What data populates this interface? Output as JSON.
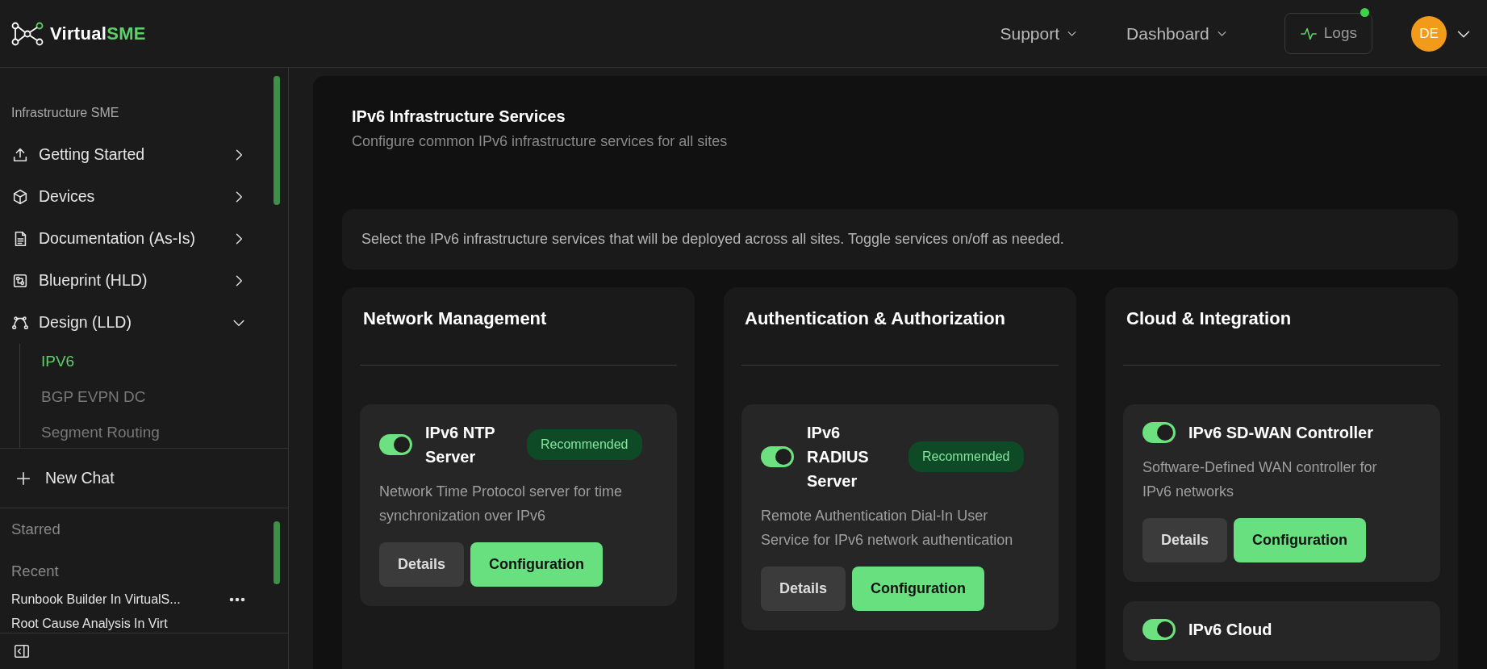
{
  "header": {
    "brand": {
      "text_main": "Virtual",
      "text_accent": "SME"
    },
    "menus": [
      {
        "label": "Support"
      },
      {
        "label": "Dashboard"
      }
    ],
    "logs_button": {
      "label": "Logs",
      "has_notification": true
    },
    "avatar": {
      "initials": "DE"
    }
  },
  "sidebar": {
    "section_label": "Infrastructure SME",
    "items": [
      {
        "label": "Getting Started",
        "expanded": false
      },
      {
        "label": "Devices",
        "expanded": false
      },
      {
        "label": "Documentation (As-Is)",
        "expanded": false
      },
      {
        "label": "Blueprint (HLD)",
        "expanded": false
      },
      {
        "label": "Design (LLD)",
        "expanded": true,
        "children": [
          {
            "label": "IPV6",
            "selected": true
          },
          {
            "label": "BGP EVPN DC",
            "selected": false
          },
          {
            "label": "Segment Routing",
            "selected": false
          }
        ]
      }
    ],
    "new_chat": "New Chat",
    "starred_label": "Starred",
    "recent_label": "Recent",
    "recent_chats": [
      {
        "title": "Runbook Builder In VirtualS..."
      },
      {
        "title": "Root Cause Analysis In Virt"
      }
    ]
  },
  "main": {
    "title": "IPv6 Infrastructure Services",
    "subtitle": "Configure common IPv6 infrastructure services for all sites",
    "info": "Select the IPv6 infrastructure services that will be deployed across all sites. Toggle services on/off as needed.",
    "categories": [
      {
        "title": "Network Management",
        "services": [
          {
            "name": "IPv6 NTP Server",
            "on": true,
            "badge": "Recommended",
            "description": "Network Time Protocol server for time synchronization over IPv6",
            "buttons": [
              "Details",
              "Configuration"
            ]
          }
        ]
      },
      {
        "title": "Authentication & Authorization",
        "services": [
          {
            "name": "IPv6 RADIUS Server",
            "on": true,
            "badge": "Recommended",
            "description": "Remote Authentication Dial-In User Service for IPv6 network authentication",
            "buttons": [
              "Details",
              "Configuration"
            ]
          }
        ]
      },
      {
        "title": "Cloud & Integration",
        "services": [
          {
            "name": "IPv6 SD-WAN Controller",
            "on": true,
            "description": "Software-Defined WAN controller for IPv6 networks",
            "buttons": [
              "Details",
              "Configuration"
            ]
          },
          {
            "name": "IPv6 Cloud",
            "on": true
          }
        ]
      }
    ]
  }
}
